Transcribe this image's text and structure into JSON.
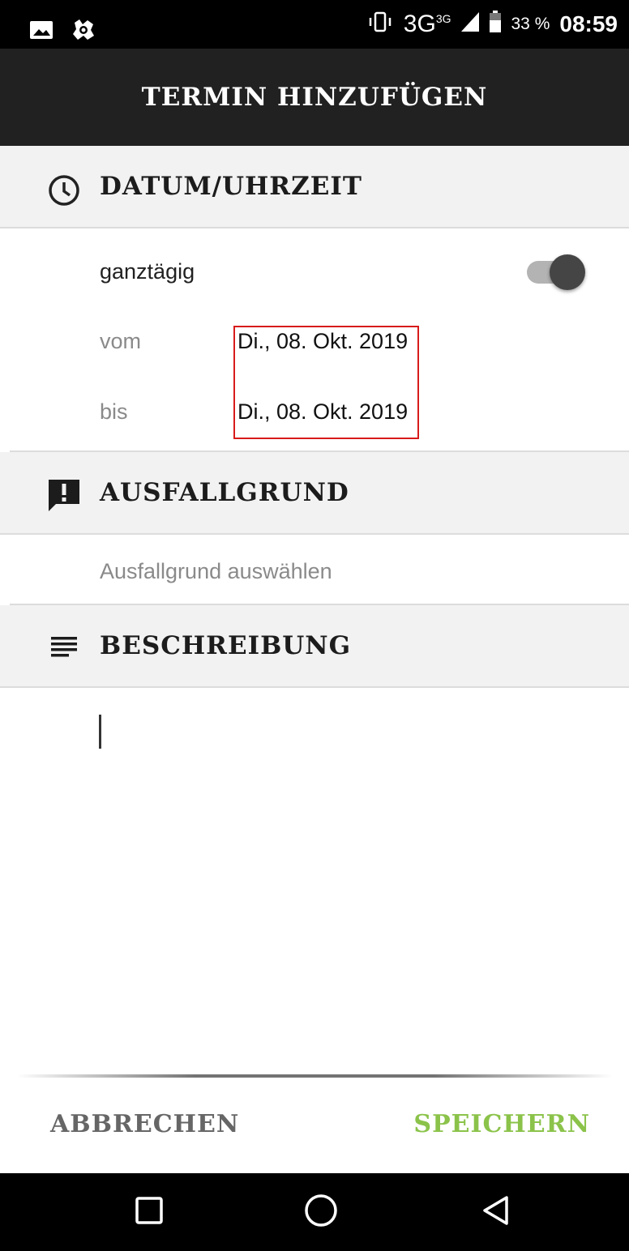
{
  "status_bar": {
    "network": "3G",
    "network_badge": "3G",
    "battery_percent": "33 %",
    "time": "08:59"
  },
  "app_bar": {
    "title": "TERMIN HINZUFÜGEN"
  },
  "sections": {
    "datetime": {
      "title": "DATUM/UHRZEIT"
    },
    "reason": {
      "title": "AUSFALLGRUND"
    },
    "description": {
      "title": "BESCHREIBUNG"
    }
  },
  "datetime": {
    "all_day_label": "ganztägig",
    "all_day_on": true,
    "from_label": "vom",
    "from_value": "Di., 08. Okt. 2019",
    "to_label": "bis",
    "to_value": "Di., 08. Okt. 2019"
  },
  "reason": {
    "placeholder": "Ausfallgrund auswählen"
  },
  "description": {
    "value": ""
  },
  "footer": {
    "cancel_label": "ABBRECHEN",
    "save_label": "SPEICHERN"
  },
  "colors": {
    "accent": "#8bc34a",
    "app_bar": "#212121",
    "highlight": "#d81b1b"
  }
}
